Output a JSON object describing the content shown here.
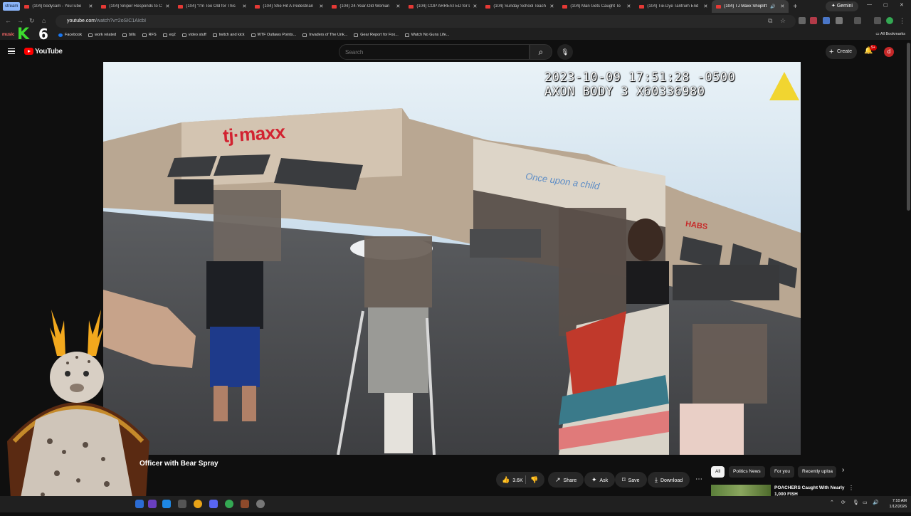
{
  "browser": {
    "stream_tag": "stream",
    "tabs": [
      {
        "title": "(104) bodycam - YouTube"
      },
      {
        "title": "(104) Sniper Responds to C"
      },
      {
        "title": "(104) \"I'm Too Old for This"
      },
      {
        "title": "(104) She Hit A Pedestrian"
      },
      {
        "title": "(104) 24-Year-Old Woman"
      },
      {
        "title": "(104) COP ARRESTED for D"
      },
      {
        "title": "(104) Sunday School Teach"
      },
      {
        "title": "(104) Man Gets Caught Te"
      },
      {
        "title": "(104) Tie-Dye Tantrum End"
      },
      {
        "title": "(104) TJ Maxx Shoplift"
      }
    ],
    "new_tab": "+",
    "gemini_label": "Gemini",
    "url_host": "youtube.com",
    "url_path": "/watch?v=2oSIC1AIcbI",
    "bookmarks": [
      {
        "label": "Facebook",
        "icon": "facebook-icon"
      },
      {
        "label": "work related",
        "icon": "folder-icon"
      },
      {
        "label": "bills",
        "icon": "folder-icon"
      },
      {
        "label": "RFS",
        "icon": "folder-icon"
      },
      {
        "label": "eq2",
        "icon": "folder-icon"
      },
      {
        "label": "video stuff",
        "icon": "folder-icon"
      },
      {
        "label": "twitch and kick",
        "icon": "folder-icon"
      },
      {
        "label": "WTF Outlaws Points...",
        "icon": "page-icon"
      },
      {
        "label": "Invaders of The Unk...",
        "icon": "page-icon"
      },
      {
        "label": "Gear Report for Fox...",
        "icon": "page-icon"
      },
      {
        "label": "Watch No Guns Life...",
        "icon": "page-icon"
      }
    ],
    "all_bookmarks": "All Bookmarks"
  },
  "youtube": {
    "logo_text": "YouTube",
    "search_placeholder": "Search",
    "create_label": "Create",
    "notif_badge": "9+",
    "avatar_letter": "d",
    "video": {
      "osd_line1": "2023-10-09 17:51:28 -0500",
      "osd_line2": "AXON BODY 3 X60336980",
      "store_sign": "tj·maxx",
      "sign2": "Once upon a child",
      "sign3": "HABS"
    },
    "title_visible": "Officer with Bear Spray",
    "actions": {
      "likes": "3.6K",
      "share": "Share",
      "ask": "Ask",
      "save": "Save",
      "download": "Download",
      "more": "⋯"
    },
    "chips": [
      "All",
      "Politics News",
      "For you",
      "Recently uploa"
    ],
    "recommendation": {
      "title": "POACHERS Caught With Nearly 1,000 FISH"
    }
  },
  "stream_overlay": {
    "brand_letter": "K",
    "brand_number": "6",
    "brand_small": "music"
  },
  "taskbar": {
    "time": "7:10 AM",
    "date": "1/12/2026"
  },
  "colors": {
    "yt_red": "#ff0000",
    "bg": "#0f0f0f",
    "chrome_bg": "#1f1f1f",
    "accent_green": "#3ddc2f"
  }
}
